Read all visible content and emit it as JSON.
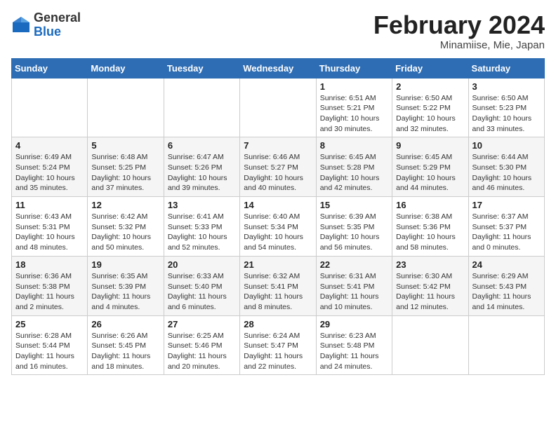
{
  "header": {
    "logo": {
      "general": "General",
      "blue": "Blue"
    },
    "title": "February 2024",
    "subtitle": "Minamiise, Mie, Japan"
  },
  "weekdays": [
    "Sunday",
    "Monday",
    "Tuesday",
    "Wednesday",
    "Thursday",
    "Friday",
    "Saturday"
  ],
  "weeks": [
    [
      {
        "day": "",
        "info": ""
      },
      {
        "day": "",
        "info": ""
      },
      {
        "day": "",
        "info": ""
      },
      {
        "day": "",
        "info": ""
      },
      {
        "day": "1",
        "info": "Sunrise: 6:51 AM\nSunset: 5:21 PM\nDaylight: 10 hours\nand 30 minutes."
      },
      {
        "day": "2",
        "info": "Sunrise: 6:50 AM\nSunset: 5:22 PM\nDaylight: 10 hours\nand 32 minutes."
      },
      {
        "day": "3",
        "info": "Sunrise: 6:50 AM\nSunset: 5:23 PM\nDaylight: 10 hours\nand 33 minutes."
      }
    ],
    [
      {
        "day": "4",
        "info": "Sunrise: 6:49 AM\nSunset: 5:24 PM\nDaylight: 10 hours\nand 35 minutes."
      },
      {
        "day": "5",
        "info": "Sunrise: 6:48 AM\nSunset: 5:25 PM\nDaylight: 10 hours\nand 37 minutes."
      },
      {
        "day": "6",
        "info": "Sunrise: 6:47 AM\nSunset: 5:26 PM\nDaylight: 10 hours\nand 39 minutes."
      },
      {
        "day": "7",
        "info": "Sunrise: 6:46 AM\nSunset: 5:27 PM\nDaylight: 10 hours\nand 40 minutes."
      },
      {
        "day": "8",
        "info": "Sunrise: 6:45 AM\nSunset: 5:28 PM\nDaylight: 10 hours\nand 42 minutes."
      },
      {
        "day": "9",
        "info": "Sunrise: 6:45 AM\nSunset: 5:29 PM\nDaylight: 10 hours\nand 44 minutes."
      },
      {
        "day": "10",
        "info": "Sunrise: 6:44 AM\nSunset: 5:30 PM\nDaylight: 10 hours\nand 46 minutes."
      }
    ],
    [
      {
        "day": "11",
        "info": "Sunrise: 6:43 AM\nSunset: 5:31 PM\nDaylight: 10 hours\nand 48 minutes."
      },
      {
        "day": "12",
        "info": "Sunrise: 6:42 AM\nSunset: 5:32 PM\nDaylight: 10 hours\nand 50 minutes."
      },
      {
        "day": "13",
        "info": "Sunrise: 6:41 AM\nSunset: 5:33 PM\nDaylight: 10 hours\nand 52 minutes."
      },
      {
        "day": "14",
        "info": "Sunrise: 6:40 AM\nSunset: 5:34 PM\nDaylight: 10 hours\nand 54 minutes."
      },
      {
        "day": "15",
        "info": "Sunrise: 6:39 AM\nSunset: 5:35 PM\nDaylight: 10 hours\nand 56 minutes."
      },
      {
        "day": "16",
        "info": "Sunrise: 6:38 AM\nSunset: 5:36 PM\nDaylight: 10 hours\nand 58 minutes."
      },
      {
        "day": "17",
        "info": "Sunrise: 6:37 AM\nSunset: 5:37 PM\nDaylight: 11 hours\nand 0 minutes."
      }
    ],
    [
      {
        "day": "18",
        "info": "Sunrise: 6:36 AM\nSunset: 5:38 PM\nDaylight: 11 hours\nand 2 minutes."
      },
      {
        "day": "19",
        "info": "Sunrise: 6:35 AM\nSunset: 5:39 PM\nDaylight: 11 hours\nand 4 minutes."
      },
      {
        "day": "20",
        "info": "Sunrise: 6:33 AM\nSunset: 5:40 PM\nDaylight: 11 hours\nand 6 minutes."
      },
      {
        "day": "21",
        "info": "Sunrise: 6:32 AM\nSunset: 5:41 PM\nDaylight: 11 hours\nand 8 minutes."
      },
      {
        "day": "22",
        "info": "Sunrise: 6:31 AM\nSunset: 5:41 PM\nDaylight: 11 hours\nand 10 minutes."
      },
      {
        "day": "23",
        "info": "Sunrise: 6:30 AM\nSunset: 5:42 PM\nDaylight: 11 hours\nand 12 minutes."
      },
      {
        "day": "24",
        "info": "Sunrise: 6:29 AM\nSunset: 5:43 PM\nDaylight: 11 hours\nand 14 minutes."
      }
    ],
    [
      {
        "day": "25",
        "info": "Sunrise: 6:28 AM\nSunset: 5:44 PM\nDaylight: 11 hours\nand 16 minutes."
      },
      {
        "day": "26",
        "info": "Sunrise: 6:26 AM\nSunset: 5:45 PM\nDaylight: 11 hours\nand 18 minutes."
      },
      {
        "day": "27",
        "info": "Sunrise: 6:25 AM\nSunset: 5:46 PM\nDaylight: 11 hours\nand 20 minutes."
      },
      {
        "day": "28",
        "info": "Sunrise: 6:24 AM\nSunset: 5:47 PM\nDaylight: 11 hours\nand 22 minutes."
      },
      {
        "day": "29",
        "info": "Sunrise: 6:23 AM\nSunset: 5:48 PM\nDaylight: 11 hours\nand 24 minutes."
      },
      {
        "day": "",
        "info": ""
      },
      {
        "day": "",
        "info": ""
      }
    ]
  ]
}
